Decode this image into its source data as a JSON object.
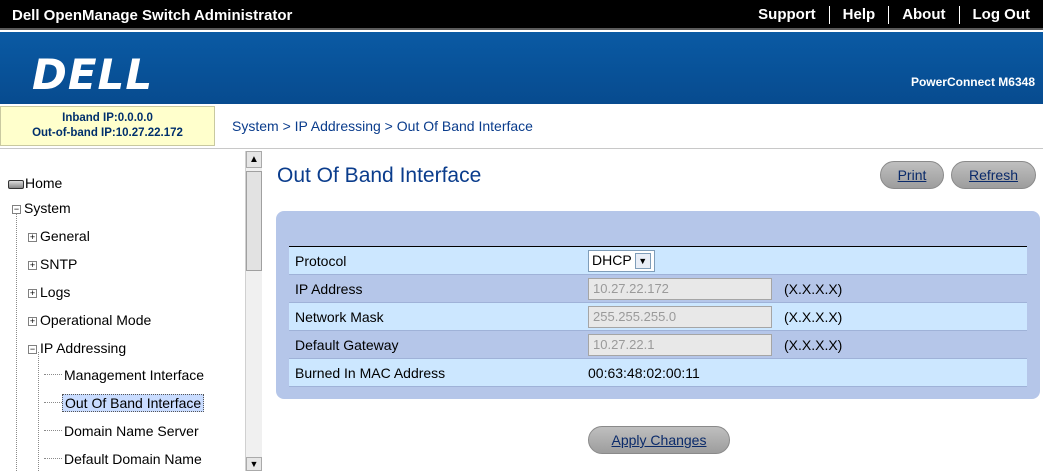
{
  "header": {
    "app_title": "Dell OpenManage Switch Administrator",
    "links": [
      "Support",
      "Help",
      "About",
      "Log Out"
    ],
    "logo": "DELL",
    "model": "PowerConnect M6348"
  },
  "ip_info": {
    "inband": "Inband IP:0.0.0.0",
    "outofband": "Out-of-band IP:10.27.22.172"
  },
  "breadcrumb": {
    "system": "System",
    "sep1": " > ",
    "ip": "IP Addressing",
    "sep2": " > ",
    "current": "Out Of Band Interface"
  },
  "sidebar": {
    "home": "Home",
    "system": "System",
    "general": "General",
    "sntp": "SNTP",
    "logs": "Logs",
    "operational": "Operational Mode",
    "ip_addressing": "IP Addressing",
    "mgmt": "Management Interface",
    "oob": "Out Of Band Interface",
    "dns": "Domain Name Server",
    "default_domain": "Default Domain Name"
  },
  "main": {
    "title": "Out Of Band Interface",
    "print": "Print",
    "refresh": "Refresh",
    "apply": "Apply Changes",
    "rows": {
      "protocol_label": "Protocol",
      "protocol_value": "DHCP",
      "ip_label": "IP Address",
      "ip_value": "10.27.22.172",
      "ip_fmt": "(X.X.X.X)",
      "mask_label": "Network Mask",
      "mask_value": "255.255.255.0",
      "mask_fmt": "(X.X.X.X)",
      "gw_label": "Default Gateway",
      "gw_value": "10.27.22.1",
      "gw_fmt": "(X.X.X.X)",
      "mac_label": "Burned In MAC Address",
      "mac_value": "00:63:48:02:00:11"
    }
  }
}
